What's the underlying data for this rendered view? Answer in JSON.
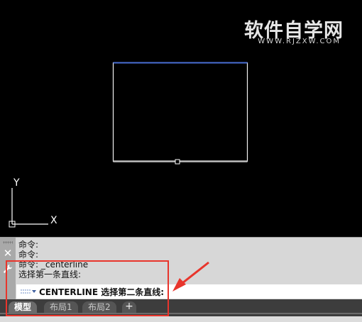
{
  "watermark": {
    "main": "软件自学网",
    "sub": "WWW.RJZXW.COM"
  },
  "ucs": {
    "y_label": "Y",
    "x_label": "X"
  },
  "command_history": [
    "命令:",
    "命令:",
    "命令: _centerline",
    "选择第一条直线:"
  ],
  "command_line": {
    "prompt": "CENTERLINE 选择第二条直线:"
  },
  "layout_tabs": [
    {
      "label": "模型",
      "active": true
    },
    {
      "label": "布局1",
      "active": false
    },
    {
      "label": "布局2",
      "active": false
    }
  ],
  "add_tab_label": "+",
  "colors": {
    "background": "#000000",
    "rectangle": "#ffffff",
    "rectangle_top": "#4a6fd6",
    "highlight": "#e8352c"
  },
  "icons": {
    "close": "close-icon",
    "customize": "wrench-icon",
    "recent_commands": "command-recent-icon",
    "grip": "grip-icon",
    "ucs": "ucs-icon",
    "grip_point": "grip-square-icon"
  }
}
